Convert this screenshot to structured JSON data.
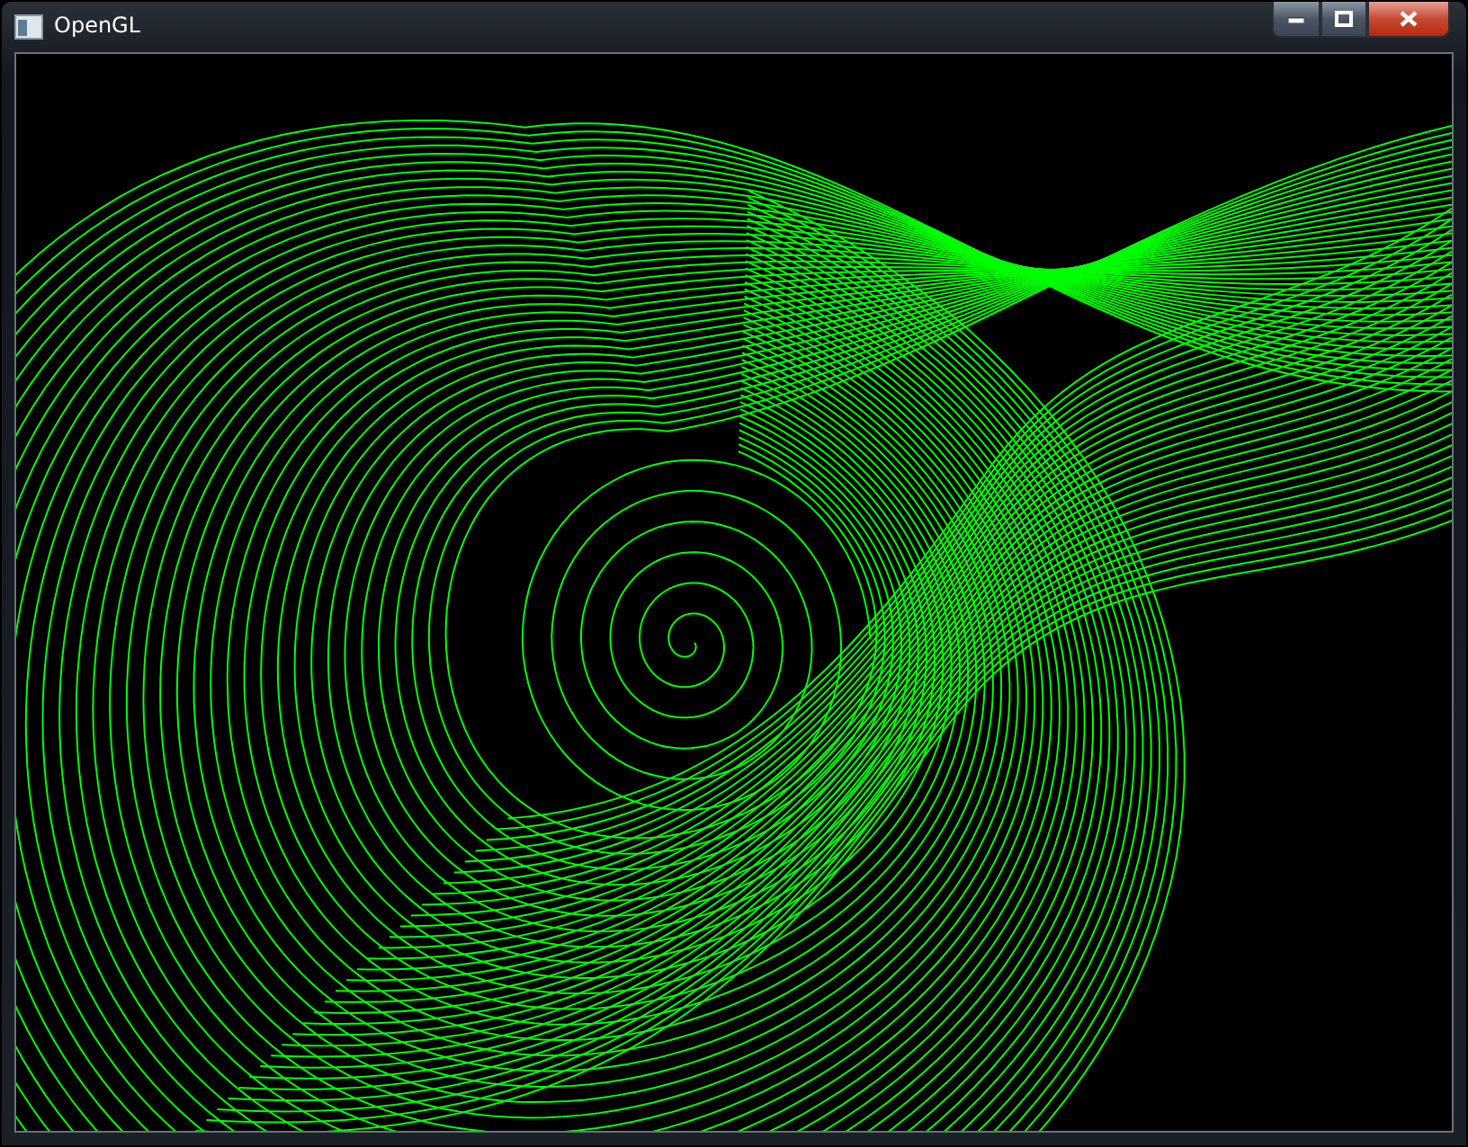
{
  "window": {
    "title": "OpenGL"
  }
}
